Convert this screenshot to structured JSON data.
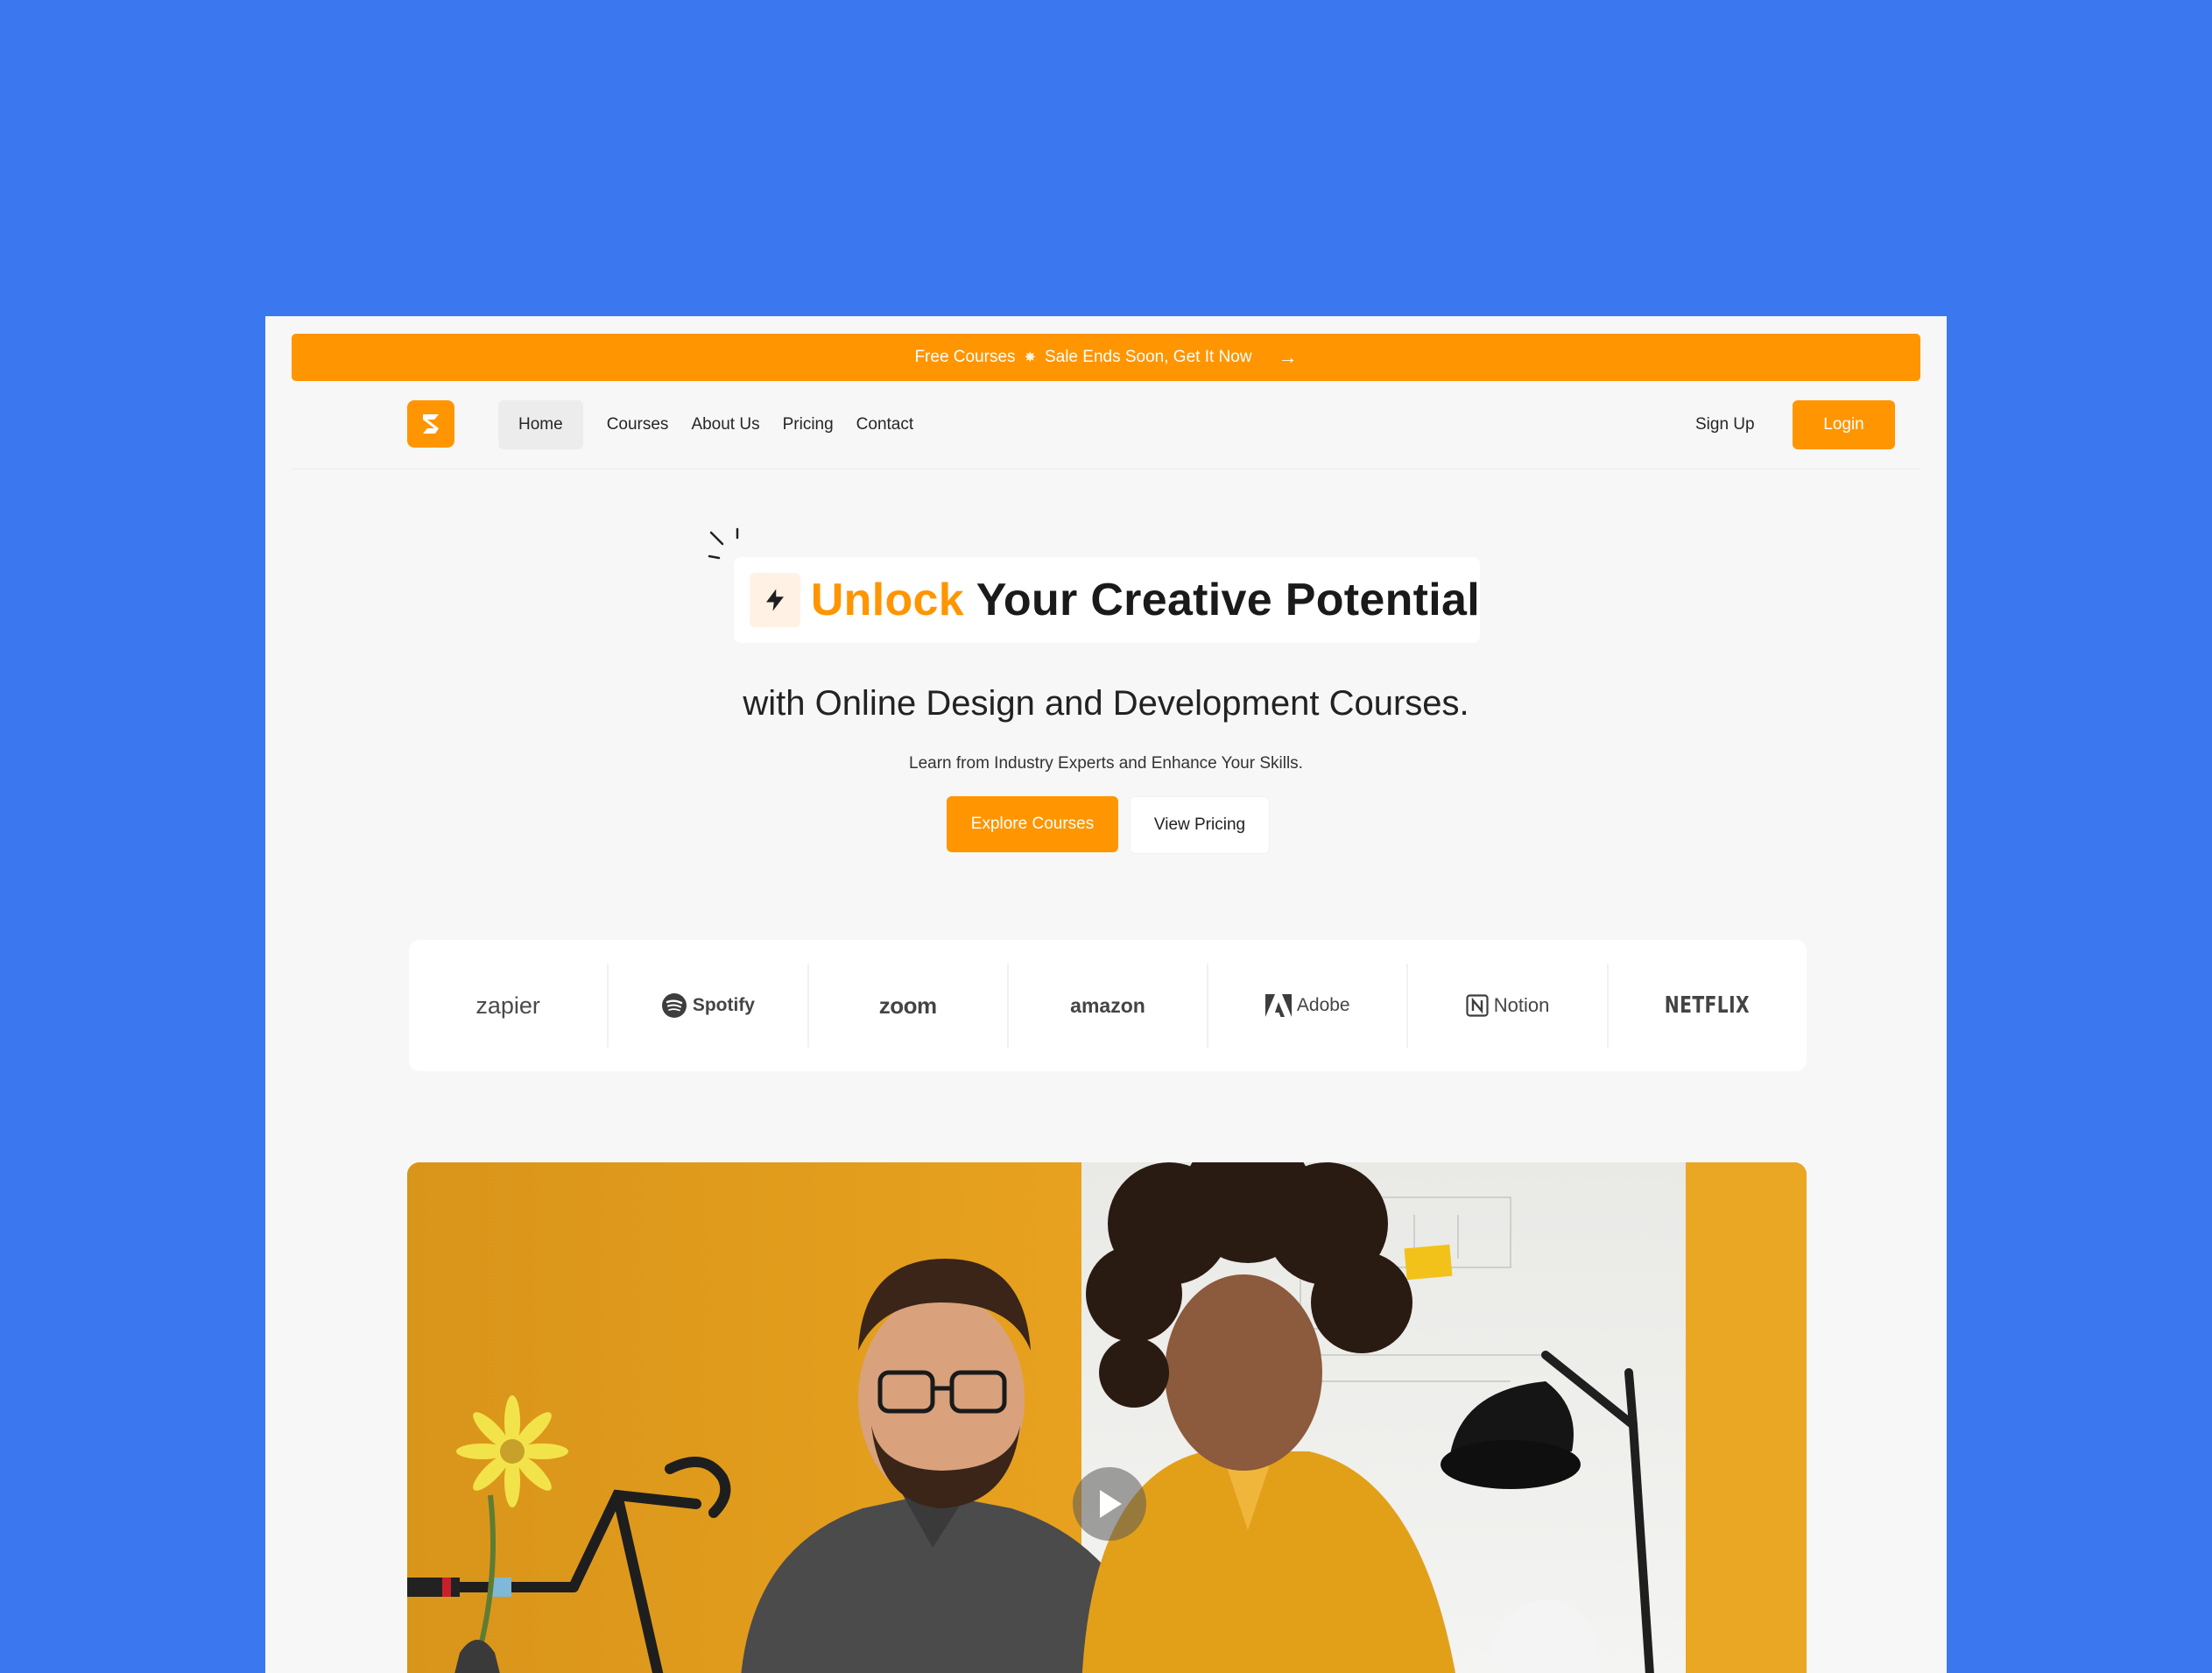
{
  "announcement": {
    "text_before": "Free Courses",
    "text_after": "Sale Ends Soon, Get It Now",
    "spark_glyph": "✸",
    "arrow_glyph": "→"
  },
  "nav": {
    "links": [
      "Home",
      "Courses",
      "About Us",
      "Pricing",
      "Contact"
    ],
    "signup": "Sign Up",
    "login": "Login"
  },
  "hero": {
    "headline_accent": "Unlock",
    "headline_rest": "Your Creative Potential",
    "subheadline": "with Online Design and Development Courses.",
    "tagline": "Learn from Industry Experts and Enhance Your Skills.",
    "primary_cta": "Explore Courses",
    "secondary_cta": "View Pricing"
  },
  "partners": [
    "zapier",
    "Spotify",
    "zoom",
    "amazon",
    "Adobe",
    "Notion",
    "NETFLIX"
  ],
  "colors": {
    "background": "#3b78ef",
    "accent": "#ff9500",
    "page": "#f7f7f7"
  },
  "icons": {
    "logo": "brand-s-logo-icon",
    "bolt": "lightning-bolt-icon",
    "arrow": "arrow-right-icon",
    "play": "play-icon"
  }
}
